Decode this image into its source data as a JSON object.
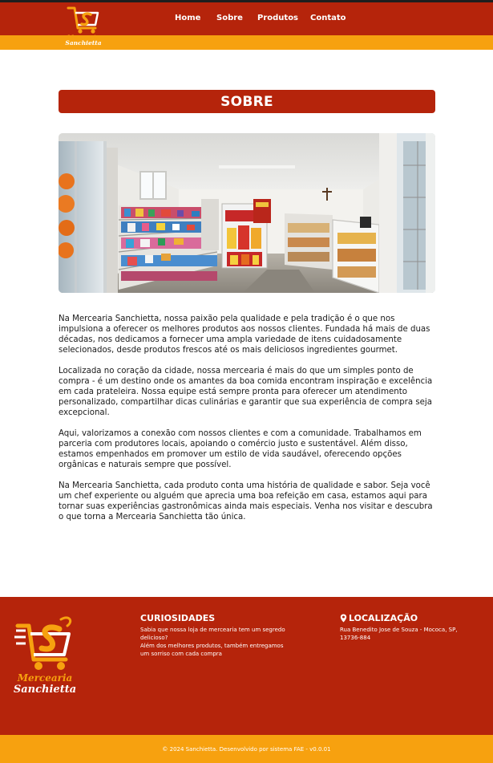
{
  "brand": {
    "name_line1": "Mercearia",
    "name_line2": "Sanchietta",
    "logo_icon": "shopping-cart-s-logo"
  },
  "nav": {
    "items": [
      {
        "label": "Home"
      },
      {
        "label": "Sobre"
      },
      {
        "label": "Produtos"
      },
      {
        "label": "Contato"
      }
    ]
  },
  "main": {
    "title": "SOBRE",
    "hero_image": "store-interior-panorama",
    "paragraphs": [
      "Na Mercearia Sanchietta, nossa paixão pela qualidade e pela tradição é o que nos impulsiona a oferecer os melhores produtos aos nossos clientes. Fundada há mais de duas décadas, nos dedicamos a fornecer uma ampla variedade de itens cuidadosamente selecionados, desde produtos frescos até os mais deliciosos ingredientes gourmet.",
      "Localizada no coração da cidade, nossa mercearia é mais do que um simples ponto de compra - é um destino onde os amantes da boa comida encontram inspiração e excelência em cada prateleira. Nossa equipe está sempre pronta para oferecer um atendimento personalizado, compartilhar dicas culinárias e garantir que sua experiência de compra seja excepcional.",
      "Aqui, valorizamos a conexão com nossos clientes e com a comunidade. Trabalhamos em parceria com produtores locais, apoiando o comércio justo e sustentável. Além disso, estamos empenhados em promover um estilo de vida saudável, oferecendo opções orgânicas e naturais sempre que possível.",
      "Na Mercearia Sanchietta, cada produto conta uma história de qualidade e sabor. Seja você um chef experiente ou alguém que aprecia uma boa refeição em casa, estamos aqui para tornar suas experiências gastronômicas ainda mais especiais. Venha nos visitar e descubra o que torna a Mercearia Sanchietta tão única."
    ]
  },
  "footer": {
    "curiosidades": {
      "title": "CURIOSIDADES",
      "line1": "Sabia que nossa loja de mercearia tem um segredo delicioso?",
      "line2": "Além dos melhores produtos, também entregamos um sorriso com cada compra"
    },
    "localizacao": {
      "title": "LOCALIZAÇÃO",
      "icon": "map-pin-icon",
      "address": "Rua Benedito Jose de Souza - Mococa, SP, 13736-884"
    },
    "copyright": "© 2024 Sanchietta. Desenvolvido por sistema FAE - v0.0.01"
  },
  "colors": {
    "primary": "#b5240b",
    "accent": "#f7a10f",
    "dark": "#1e1e1e",
    "text": "#1a1a1a"
  }
}
